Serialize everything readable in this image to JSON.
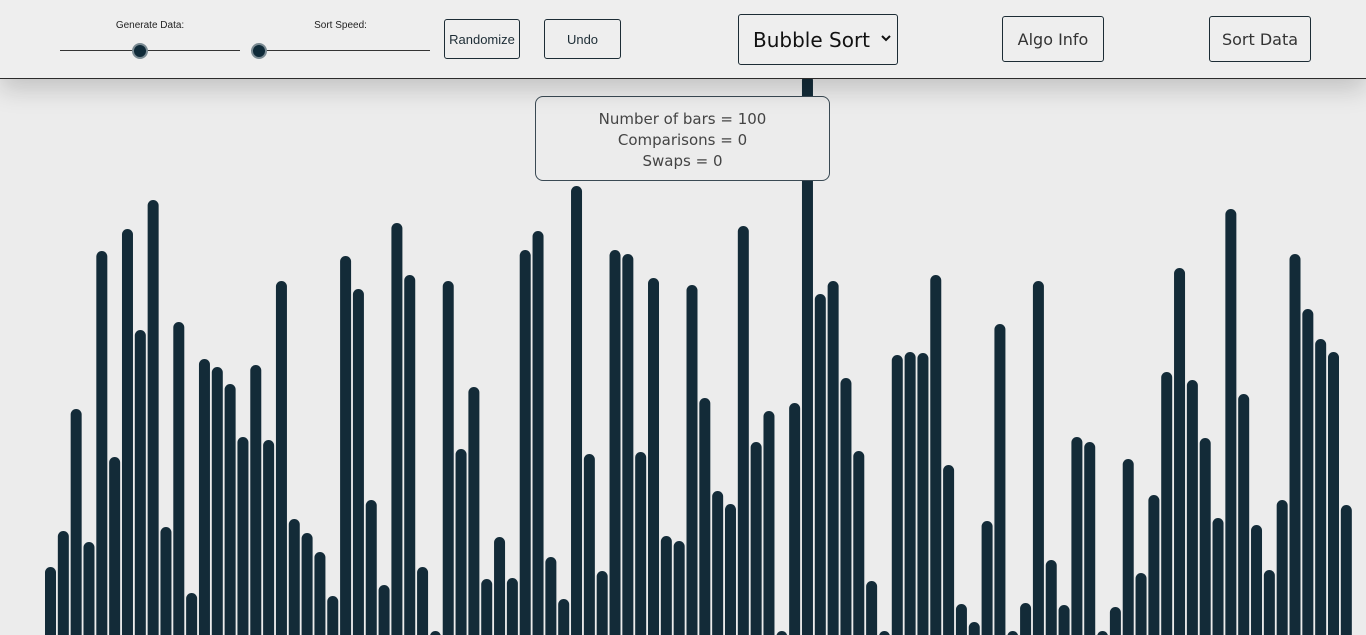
{
  "toolbar": {
    "generate_label": "Generate Data:",
    "generate_level": 0.44,
    "speed_label": "Sort Speed:",
    "speed_level": 0.0,
    "randomize_label": "Randomize",
    "undo_label": "Undo",
    "algorithm_selected": "Bubble Sort",
    "algo_info_label": "Algo Info",
    "sort_data_label": "Sort Data"
  },
  "stats": {
    "bars_line": "Number of bars = 100",
    "comparisons_line": "Comparisons = 0",
    "swaps_line": "Swaps = 0"
  },
  "colors": {
    "bar": "#132b38",
    "background": "#ececec",
    "thumb": "#0f2a38"
  },
  "chart_data": {
    "type": "bar",
    "values": [
      68,
      104,
      226,
      93,
      384,
      178,
      406,
      305,
      435,
      108,
      313,
      42,
      276,
      268,
      251,
      198,
      270,
      195,
      354,
      116,
      102,
      83,
      39,
      379,
      346,
      135,
      50,
      412,
      360,
      68,
      0,
      354,
      186,
      248,
      56,
      98,
      57,
      385,
      404,
      78,
      36,
      449,
      181,
      64,
      385,
      381,
      183,
      357,
      99,
      94,
      350,
      237,
      144,
      131,
      409,
      193,
      224,
      0,
      232,
      560,
      341,
      354,
      257,
      184,
      54,
      3,
      280,
      283,
      282,
      360,
      170,
      31,
      13,
      114,
      311,
      0,
      32,
      354,
      75,
      30,
      198,
      193,
      0,
      28,
      176,
      62,
      140,
      263,
      367,
      255,
      197,
      117,
      426,
      241,
      110,
      65,
      135,
      381,
      326,
      296,
      283,
      130
    ]
  }
}
